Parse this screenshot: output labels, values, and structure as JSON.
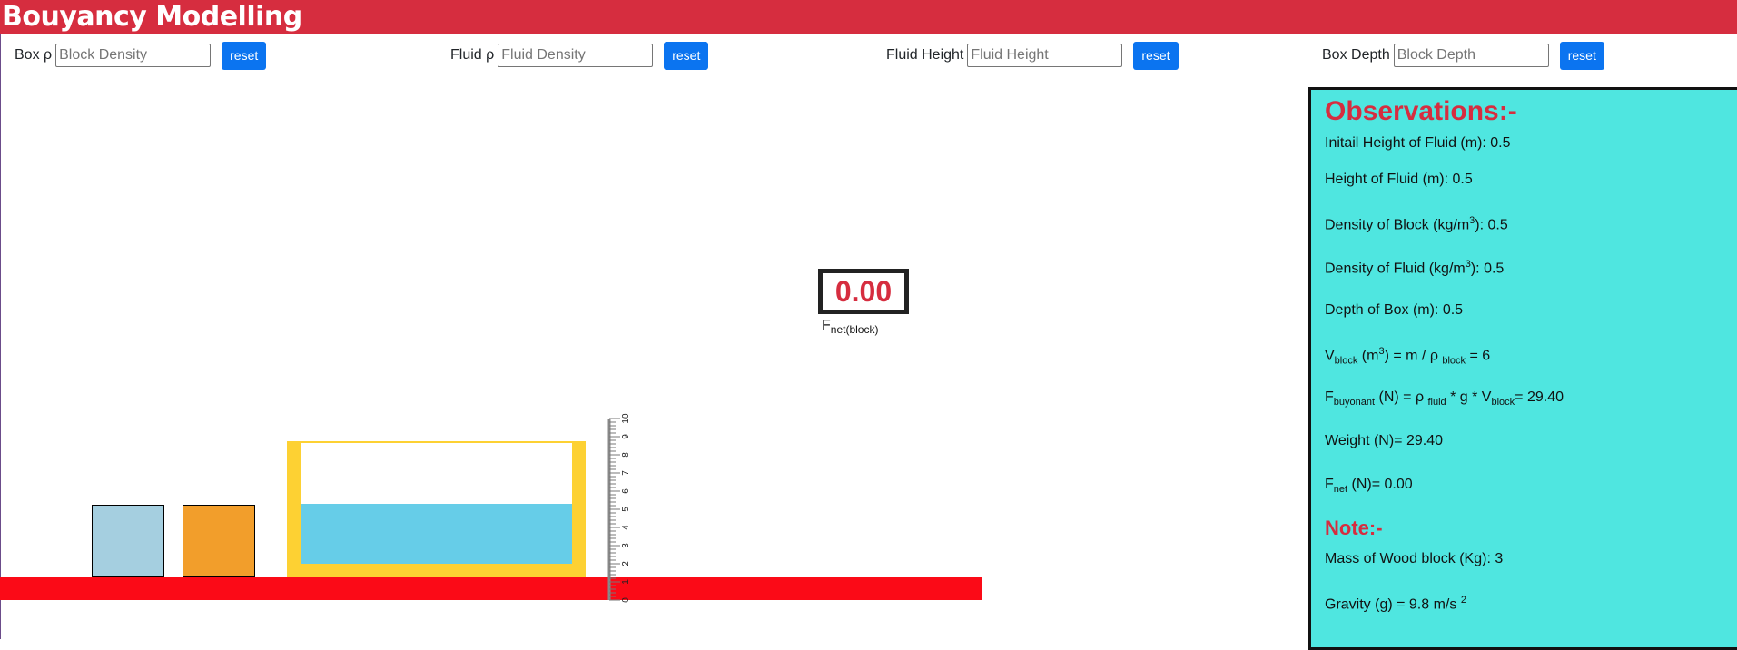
{
  "app": {
    "title": "Bouyancy Modelling"
  },
  "controls": [
    {
      "label": "Box ρ",
      "placeholder": "Block Density",
      "button": "reset"
    },
    {
      "label": "Fluid ρ",
      "placeholder": "Fluid Density",
      "button": "reset"
    },
    {
      "label": "Fluid Height",
      "placeholder": "Fluid Height",
      "button": "reset"
    },
    {
      "label": "Box Depth",
      "placeholder": "Block Depth",
      "button": "reset"
    }
  ],
  "fnet": {
    "value": "0.00",
    "label": "F",
    "label_sub": "net(block)"
  },
  "observations": {
    "heading": "Observations:-",
    "initial_height": {
      "label": "Initail Height of Fluid (m): ",
      "value": "0.5"
    },
    "fluid_height": {
      "label": "Height of Fluid (m): ",
      "value": "0.5"
    },
    "block_density": {
      "label": "Density of Block (kg/m",
      "sup": "3",
      "label_end": "): ",
      "value": "0.5"
    },
    "fluid_density": {
      "label": "Density of Fluid (kg/m",
      "sup": "3",
      "label_end": "): ",
      "value": "0.5"
    },
    "box_depth": {
      "label": "Depth of Box (m): ",
      "value": "0.5"
    },
    "v_block": {
      "v": "V",
      "v_sub": "block",
      "mid": " (m",
      "sup": "3",
      "mid2": ") = m / ρ ",
      "rho_sub": "block",
      "eq": " = ",
      "value": "6"
    },
    "f_buoyant": {
      "f": "F",
      "f_sub": "buyonant",
      "mid": " (N) = ρ ",
      "rho_sub": "fluid",
      "mid2": " * g * V",
      "v_sub": "block",
      "eq": "= ",
      "value": "29.40"
    },
    "weight": {
      "label": "Weight (N)= ",
      "value": "29.40"
    },
    "fnet": {
      "f": "F",
      "f_sub": "net",
      "label": " (N)= ",
      "value": "0.00"
    }
  },
  "note": {
    "heading": "Note:-",
    "mass": {
      "label": "Mass of Wood block (Kg): ",
      "value": "3"
    },
    "gravity": {
      "label": "Gravity (g) = 9.8 m/s ",
      "sup": "2"
    }
  },
  "simulation": {
    "fluid_level": 0.5,
    "ruler": {
      "ticks": [
        "0",
        "1",
        "2",
        "3",
        "4",
        "5",
        "6",
        "7",
        "8",
        "9",
        "10"
      ]
    }
  },
  "colors": {
    "header": "#d62d3f",
    "button": "#0b74f0",
    "panel": "#4fe6e0",
    "ground": "#fb0a17",
    "tank": "#fdd133",
    "fluid": "#66cde8",
    "wood_block": "#a5cfe0",
    "orange_block": "#f29e2b"
  }
}
